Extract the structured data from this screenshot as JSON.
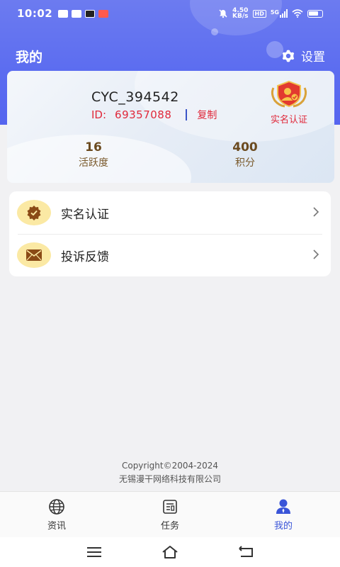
{
  "status_bar": {
    "time": "10:02",
    "net_speed_value": "4.50",
    "net_speed_unit": "KB/s",
    "hd_label": "HD",
    "network_label": "5G"
  },
  "header": {
    "title": "我的",
    "settings_label": "设置"
  },
  "profile": {
    "username": "CYC_394542",
    "id_prefix": "ID:",
    "id_value": "69357088",
    "copy_label": "复制",
    "verify_label": "实名认证",
    "stats": [
      {
        "value": "16",
        "label": "活跃度"
      },
      {
        "value": "400",
        "label": "积分"
      }
    ]
  },
  "menu": {
    "items": [
      {
        "label": "实名认证",
        "icon": "verified-badge-icon"
      },
      {
        "label": "投诉反馈",
        "icon": "envelope-icon"
      }
    ]
  },
  "footer": {
    "copyright": "Copyright©2004-2024",
    "company": "无锡漫干网络科技有限公司"
  },
  "tabs": [
    {
      "label": "资讯",
      "icon": "globe-icon",
      "active": false
    },
    {
      "label": "任务",
      "icon": "news-icon",
      "active": false
    },
    {
      "label": "我的",
      "icon": "user-icon",
      "active": true
    }
  ],
  "colors": {
    "header": "#5b6cf0",
    "accent_red": "#e0283a",
    "active_tab": "#3a55d8",
    "stat_brown": "#6b4a1f",
    "menu_icon_bg": "#fbe9a4"
  }
}
